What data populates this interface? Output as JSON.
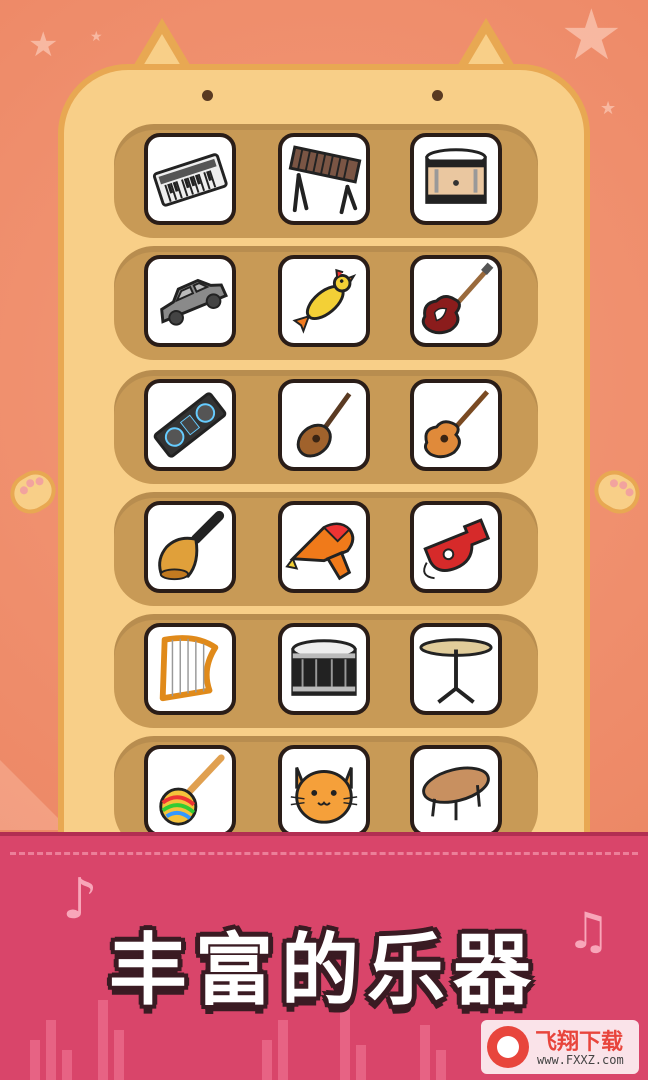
{
  "title": "丰富的乐器",
  "colors": {
    "background": "#ee8f6f",
    "cat_fur": "#f8cf88",
    "cat_outline": "#e8a852",
    "row_slot": "#c89a56",
    "banner": "#d9456a",
    "title_text": "#ffffff",
    "title_outline": "#3a1b23"
  },
  "instrument_grid": [
    [
      "electronic-keyboard-icon",
      "xylophone-icon",
      "tom-drum-icon"
    ],
    [
      "toy-car-icon",
      "rubber-chicken-icon",
      "electric-guitar-icon"
    ],
    [
      "dj-controller-icon",
      "ukulele-icon",
      "acoustic-guitar-icon"
    ],
    [
      "hand-bell-icon",
      "toy-ray-gun-icon",
      "whistle-icon"
    ],
    [
      "harp-icon",
      "snare-drum-icon",
      "cymbal-icon"
    ],
    [
      "rainbow-maraca-icon",
      "cat-face-icon",
      "wooden-table-icon"
    ]
  ],
  "watermark": {
    "brand": "飞翔下载",
    "url": "www.FXXZ.com"
  }
}
